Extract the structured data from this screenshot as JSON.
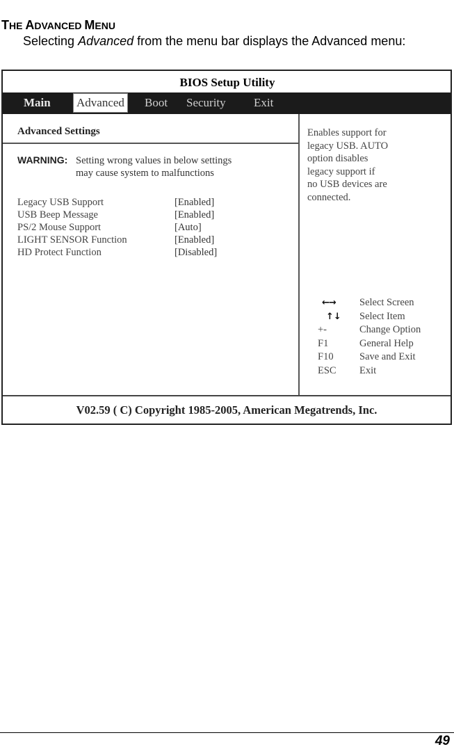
{
  "document": {
    "section_title": {
      "first_cap": "T",
      "first_rest": "HE ",
      "second_cap": "A",
      "second_rest": "DVANCED ",
      "third_cap": "M",
      "third_rest": "ENU"
    },
    "intro": {
      "before": "Selecting ",
      "emphasis": "Advanced",
      "after": " from the menu bar displays the Advanced menu:"
    },
    "page_number": "49"
  },
  "bios": {
    "title": "BIOS Setup Utility",
    "menu": [
      {
        "label": "Main",
        "active": false
      },
      {
        "label": "Advanced",
        "active": true
      },
      {
        "label": "Boot",
        "active": false
      },
      {
        "label": "Security",
        "active": false
      },
      {
        "label": "Exit",
        "active": false
      }
    ],
    "panel_heading": "Advanced Settings",
    "warning": {
      "label": "WARNING:",
      "line1": "Setting wrong values in below settings",
      "line2": "may cause system to malfunctions"
    },
    "settings": [
      {
        "name": "Legacy USB Support",
        "value": "[Enabled]"
      },
      {
        "name": "USB Beep Message",
        "value": "[Enabled]"
      },
      {
        "name": "PS/2 Mouse Support",
        "value": "[Auto]"
      },
      {
        "name": "LIGHT SENSOR Function",
        "value": "[Enabled]"
      },
      {
        "name": "HD Protect Function",
        "value": "[Disabled]"
      }
    ],
    "help_text": "Enables support for\nlegacy USB. AUTO\noption disables\nlegacy support if\nno USB devices are\nconnected.",
    "keys": [
      {
        "key": "←→",
        "icon": "left-right-arrows-icon",
        "desc": "Select Screen"
      },
      {
        "key": "↑↓",
        "icon": "up-down-arrows-icon",
        "desc": "Select Item"
      },
      {
        "key": "+-",
        "desc": "Change Option"
      },
      {
        "key": "F1",
        "desc": "General Help"
      },
      {
        "key": "F10",
        "desc": "Save and Exit"
      },
      {
        "key": "ESC",
        "desc": "Exit"
      }
    ],
    "footer": "V02.59  ( C) Copyright 1985-2005, American Megatrends, Inc."
  }
}
